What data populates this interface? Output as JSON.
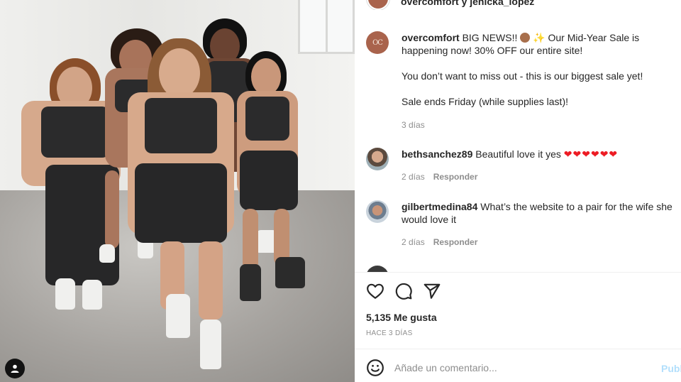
{
  "header": {
    "title": "overcomfort y jenicka_lopez"
  },
  "post": {
    "brand_avatar_text": "OC",
    "username": "overcomfort",
    "caption_line1": "BIG NEWS!!",
    "caption_line1_rest": "Our Mid-Year Sale is happening now! 30% OFF our entire site!",
    "caption_line2": "You don’t want to miss out - this is our biggest sale yet!",
    "caption_line3": "Sale ends Friday (while supplies last)!",
    "age": "3 días"
  },
  "comments": [
    {
      "username": "bethsanchez89",
      "text": "Beautiful love it yes",
      "hearts": "❤❤❤❤❤❤",
      "age": "2 días",
      "reply": "Responder"
    },
    {
      "username": "gilbertmedina84",
      "text": "What’s the website to a pair for the wife she would love it",
      "age": "2 días",
      "reply": "Responder"
    }
  ],
  "actions": {
    "like_icon": "heart-icon",
    "comment_icon": "comment-icon",
    "share_icon": "share-icon"
  },
  "likes": "5,135 Me gusta",
  "timestamp": "HACE 3 DÍAS",
  "add_comment": {
    "emoji_icon": "smiley-icon",
    "placeholder": "Añade un comentario...",
    "publish_label": "Publicar"
  },
  "colors": {
    "brand_avatar": "#a9634c",
    "publish_disabled": "#b2dffc",
    "heart_red": "#ed1c24",
    "muted_text": "#8e8e8e"
  }
}
